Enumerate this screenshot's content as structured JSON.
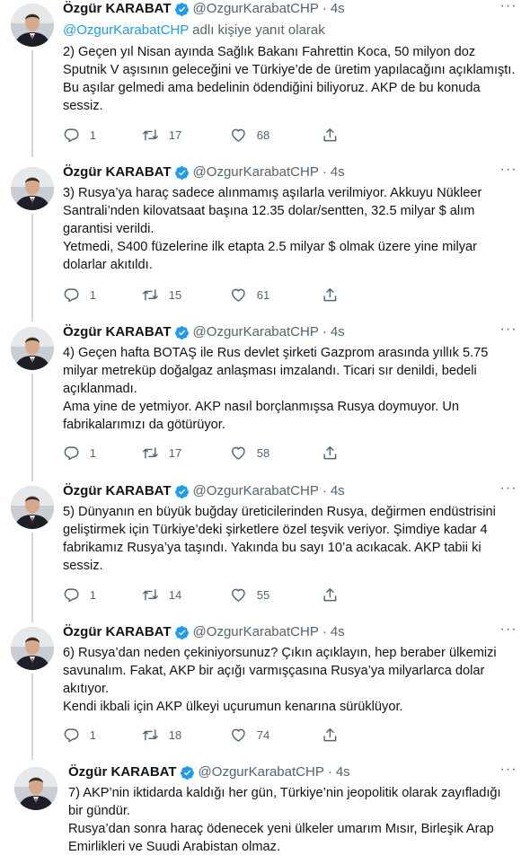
{
  "author": {
    "name": "Özgür KARABAT",
    "handle": "@OzgurKarabatCHP",
    "separator": "·",
    "time": "4s"
  },
  "reply_context": {
    "mention": "@OzgurKarabatCHP",
    "suffix": " adlı kişiye yanıt olarak"
  },
  "icons": {
    "verified": "verified-badge-icon",
    "more": "more-options-icon",
    "reply": "reply-icon",
    "retweet": "retweet-icon",
    "like": "heart-icon",
    "share": "share-icon",
    "accent": "#1d9bf0",
    "muted": "#536471"
  },
  "tweets": [
    {
      "paragraphs": [
        "2) Geçen yıl Nisan ayında Sağlık Bakanı Fahrettin Koca, 50 milyon doz Sputnik V aşısının geleceğini ve Türkiye’de de üretim yapılacağını açıklamıştı. Bu aşılar gelmedi ama bedelinin ödendiğini biliyoruz. AKP de bu konuda sessiz."
      ],
      "replies": "1",
      "retweets": "17",
      "likes": "68"
    },
    {
      "paragraphs": [
        "3) Rusya’ya haraç sadece alınmamış aşılarla verilmiyor. Akkuyu Nükleer Santrali’nden kilovatsaat başına 12.35 dolar/sentten, 32.5 milyar $ alım garantisi verildi.",
        "Yetmedi, S400 füzelerine ilk etapta 2.5 milyar $ olmak üzere yine milyar dolarlar akıtıldı."
      ],
      "replies": "1",
      "retweets": "15",
      "likes": "61"
    },
    {
      "paragraphs": [
        "4) Geçen hafta BOTAŞ ile Rus devlet şirketi Gazprom arasında yıllık 5.75 milyar metreküp doğalgaz anlaşması imzalandı. Ticari sır denildi, bedeli açıklanmadı.",
        "Ama yine de yetmiyor. AKP nasıl borçlanmışsa Rusya doymuyor. Un fabrikalarımızı da götürüyor."
      ],
      "replies": "1",
      "retweets": "17",
      "likes": "58"
    },
    {
      "paragraphs": [
        "5) Dünyanın en büyük buğday üreticilerinden Rusya, değirmen endüstrisini geliştirmek için Türkiye’deki şirketlere özel teşvik veriyor. Şimdiye kadar 4 fabrikamız Rusya’ya taşındı. Yakında bu sayı 10’a acıkacak. AKP tabii ki sessiz."
      ],
      "replies": "1",
      "retweets": "14",
      "likes": "55"
    },
    {
      "paragraphs": [
        "6) Rusya’dan neden çekiniyorsunuz? Çıkın açıklayın, hep beraber ülkemizi savunalım. Fakat, AKP bir açığı varmışçasına Rusya’ya milyarlarca dolar akıtıyor.",
        "Kendi ikbali için AKP ülkeyi uçurumun kenarına sürüklüyor."
      ],
      "replies": "1",
      "retweets": "18",
      "likes": "74"
    },
    {
      "paragraphs": [
        "7) AKP’nin iktidarda kaldığı her gün, Türkiye’nin jeopolitik olarak zayıfladığı bir gündür.",
        "Rusya’dan sonra haraç ödenecek yeni ülkeler umarım Mısır, Birleşik Arap Emirlikleri ve Suudi Arabistan olmaz."
      ]
    }
  ]
}
